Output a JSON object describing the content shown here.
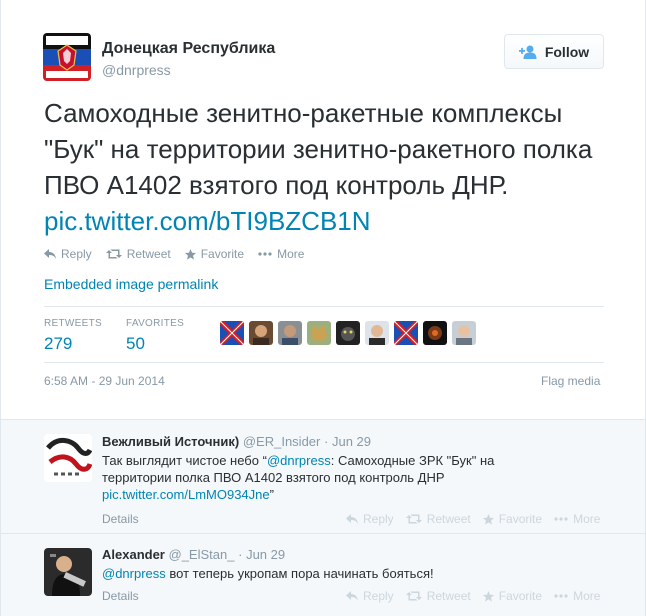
{
  "tweet": {
    "author_name": "Донецкая Республика",
    "author_handle": "@dnrpress",
    "follow_label": "Follow",
    "text": "Самоходные зенитно-ракетные комплексы \"Бук\" на территории зенитно-ракетного полка ПВО А1402 взятого под контроль ДНР. ",
    "link": "pic.twitter.com/bTI9BZCB1N",
    "actions": {
      "reply": "Reply",
      "retweet": "Retweet",
      "favorite": "Favorite",
      "more": "More"
    },
    "permalink": "Embedded image permalink",
    "stats": {
      "retweets_label": "RETWEETS",
      "retweets": "279",
      "favorites_label": "FAVORITES",
      "favorites": "50"
    },
    "timestamp": "6:58 AM - 29 Jun 2014",
    "flag": "Flag media"
  },
  "replies": [
    {
      "name": "Вежливый Источник)",
      "handle": "@ER_Insider",
      "sep": "·",
      "time": "Jun 29",
      "text_a": "Так выглядит чистое небо “",
      "mention": "@dnrpress",
      "text_b": ": Самоходные ЗРК \"Бук\" на территории полка ПВО А1402 взятого под контроль ДНР ",
      "link": "pic.twitter.com/LmMO934Jne",
      "text_c": "”",
      "details": "Details",
      "actions": {
        "reply": "Reply",
        "retweet": "Retweet",
        "favorite": "Favorite",
        "more": "More"
      }
    },
    {
      "name": "Alexander",
      "handle": "@_ElStan_",
      "sep": "·",
      "time": "Jun 29",
      "mention": "@dnrpress",
      "text": " вот теперь укропам пора начинать бояться!",
      "details": "Details",
      "actions": {
        "reply": "Reply",
        "retweet": "Retweet",
        "favorite": "Favorite",
        "more": "More"
      }
    }
  ],
  "colors": {
    "link": "#0084b4",
    "muted": "#8899a6",
    "text": "#292f33",
    "reply_bg": "#f5f8fa"
  },
  "icons": [
    "dnr-flag-avatar",
    "follow-person-icon",
    "reply-icon",
    "retweet-icon",
    "star-icon",
    "more-icon"
  ]
}
